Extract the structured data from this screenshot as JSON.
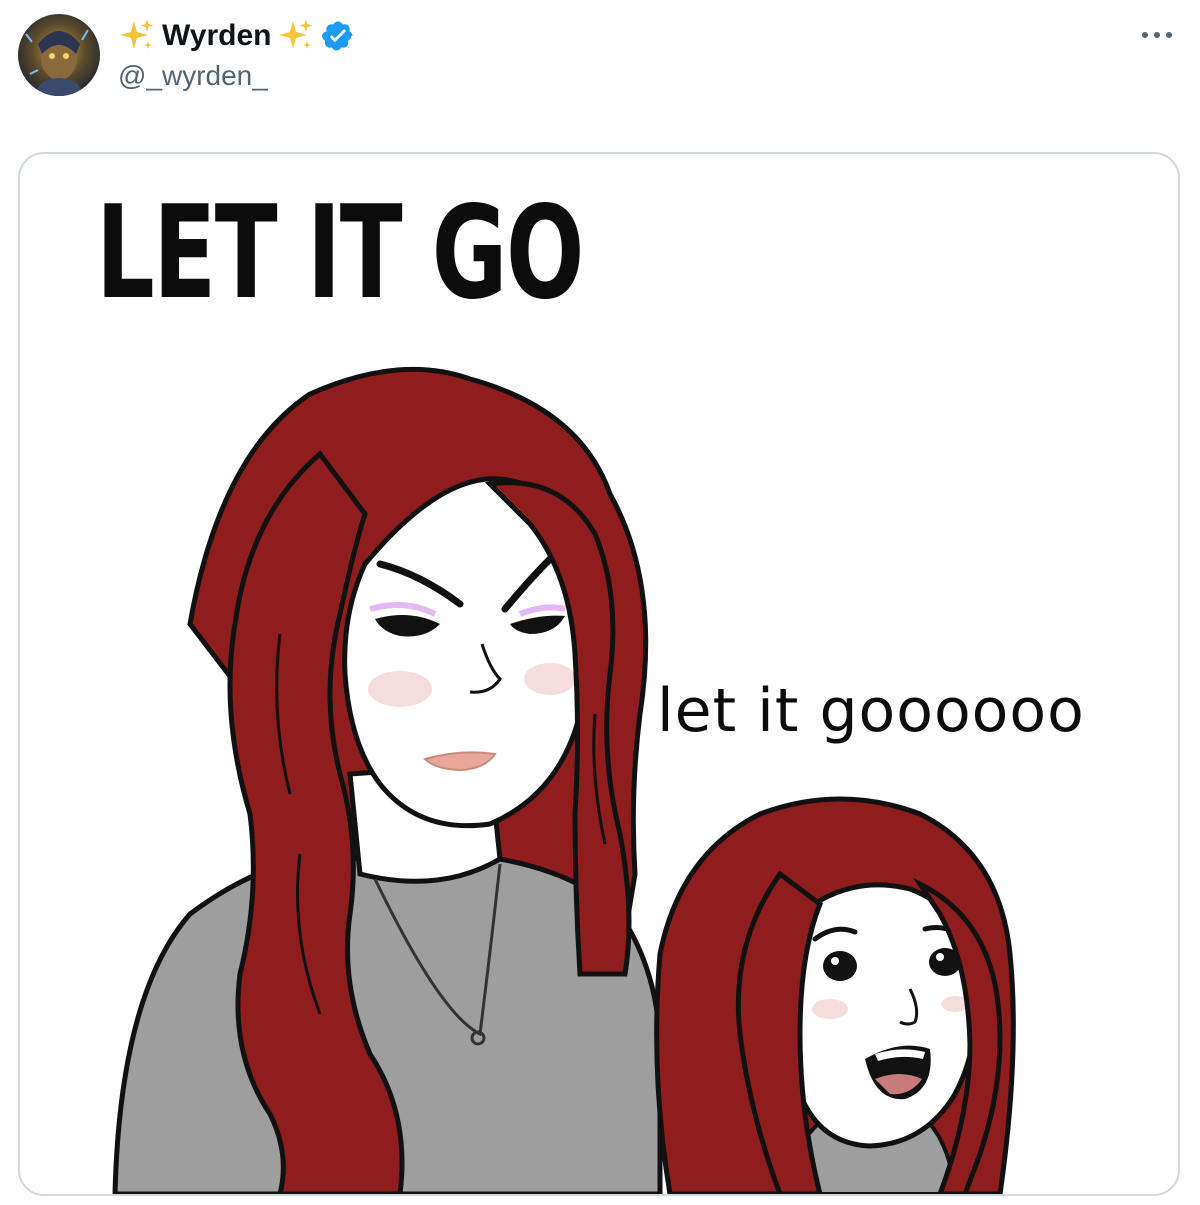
{
  "tweet": {
    "author": {
      "display_name": "Wyrden",
      "handle": "@_wyrden_",
      "verified": true,
      "name_emoji": "sparkles-icon"
    },
    "more_icon": "more-horizontal-icon"
  },
  "media": {
    "title_text": "LET IT GO",
    "caption_text": "let it goooooo",
    "colors": {
      "hair": "#8f1d1d",
      "shirt": "#9e9e9e",
      "skin": "#ffffff",
      "line": "#111111"
    }
  },
  "colors": {
    "verified_badge": "#1d9bf0",
    "handle_text": "#536471",
    "name_text": "#0f1419",
    "card_border": "#cfd9de"
  }
}
